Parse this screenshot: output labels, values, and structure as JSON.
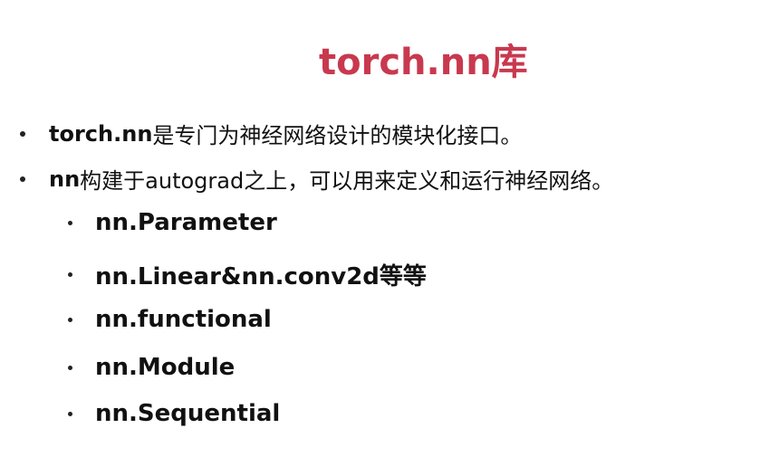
{
  "slide": {
    "title": "torch.nn库",
    "title_color": "#c8394f",
    "bullets": [
      {
        "bold": "torch.nn",
        "text": "是专门为神经网络设计的模块化接口。"
      },
      {
        "bold": "nn",
        "text": "构建于autograd之上，可以用来定义和运行神经网络。"
      }
    ],
    "sub_bullets": [
      "nn.Parameter",
      "nn.Linear&nn.conv2d等等",
      "nn.functional",
      "nn.Module",
      "nn.Sequential"
    ]
  }
}
